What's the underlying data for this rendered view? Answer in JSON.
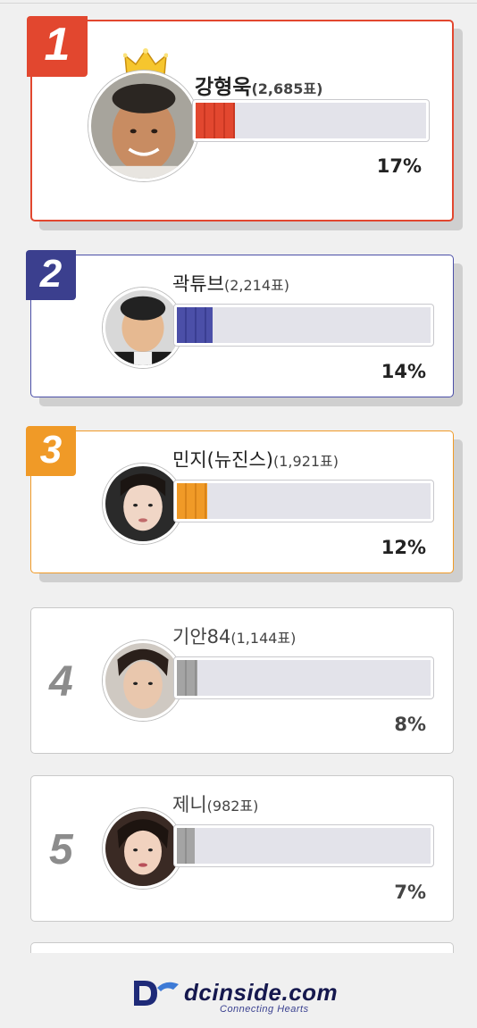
{
  "ranking": [
    {
      "rank": "1",
      "name": "강형욱",
      "votes": "(2,685표)",
      "percent": "17%",
      "fraction": 0.17,
      "accent": "#e2472f"
    },
    {
      "rank": "2",
      "name": "곽튜브",
      "votes": "(2,214표)",
      "percent": "14%",
      "fraction": 0.14,
      "accent": "#4b4fa8"
    },
    {
      "rank": "3",
      "name": "민지(뉴진스)",
      "votes": "(1,921표)",
      "percent": "12%",
      "fraction": 0.12,
      "accent": "#f09a27"
    },
    {
      "rank": "4",
      "name": "기안84",
      "votes": "(1,144표)",
      "percent": "8%",
      "fraction": 0.08,
      "accent": "#9c9c9c"
    },
    {
      "rank": "5",
      "name": "제니",
      "votes": "(982표)",
      "percent": "7%",
      "fraction": 0.07,
      "accent": "#9c9c9c"
    }
  ],
  "icons": {
    "crown": "crown-icon",
    "logo": "dcinside-logo-icon"
  },
  "footer": {
    "brand": "dcinside.com",
    "tagline": "Connecting Hearts"
  }
}
